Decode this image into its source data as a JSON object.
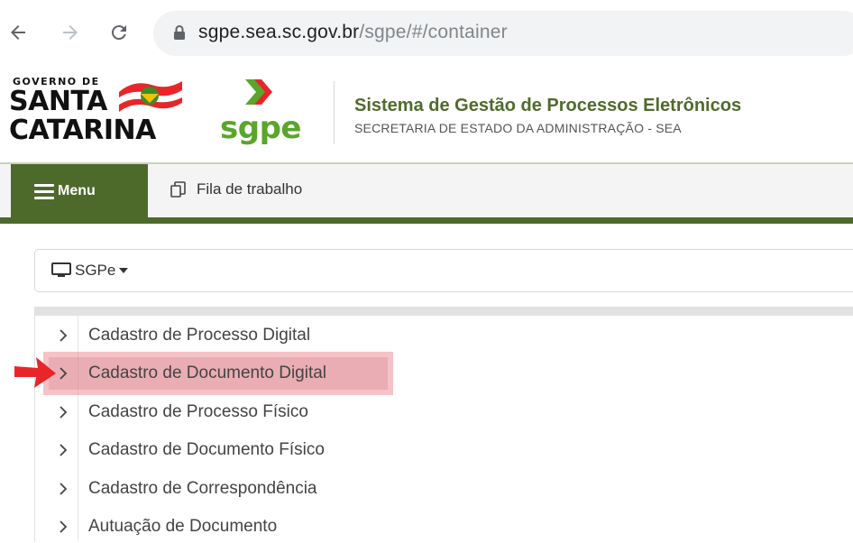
{
  "browser": {
    "url_host": "sgpe.sea.sc.gov.br",
    "url_path": "/sgpe/#/container"
  },
  "header": {
    "logo_small": "GOVERNO DE",
    "logo_line1": "SANTA",
    "logo_line2": "CATARINA",
    "sgpe_logo_text": "sgpe",
    "system_title": "Sistema de Gestão de Processos Eletrônicos",
    "system_subtitle": "SECRETARIA DE ESTADO DA ADMINISTRAÇÃO - SEA"
  },
  "navbar": {
    "menu_label": "Menu",
    "fila_label": "Fila de trabalho"
  },
  "system_selector": {
    "label": "SGPe"
  },
  "menu": {
    "items": [
      {
        "label": "Cadastro de Processo Digital"
      },
      {
        "label": "Cadastro de Documento Digital"
      },
      {
        "label": "Cadastro de Processo Físico"
      },
      {
        "label": "Cadastro de Documento Físico"
      },
      {
        "label": "Cadastro de Correspondência"
      },
      {
        "label": "Autuação de Documento"
      }
    ]
  },
  "colors": {
    "brand_green": "#4d6a2a",
    "highlight": "#e67882",
    "arrow_red": "#e8262a"
  }
}
